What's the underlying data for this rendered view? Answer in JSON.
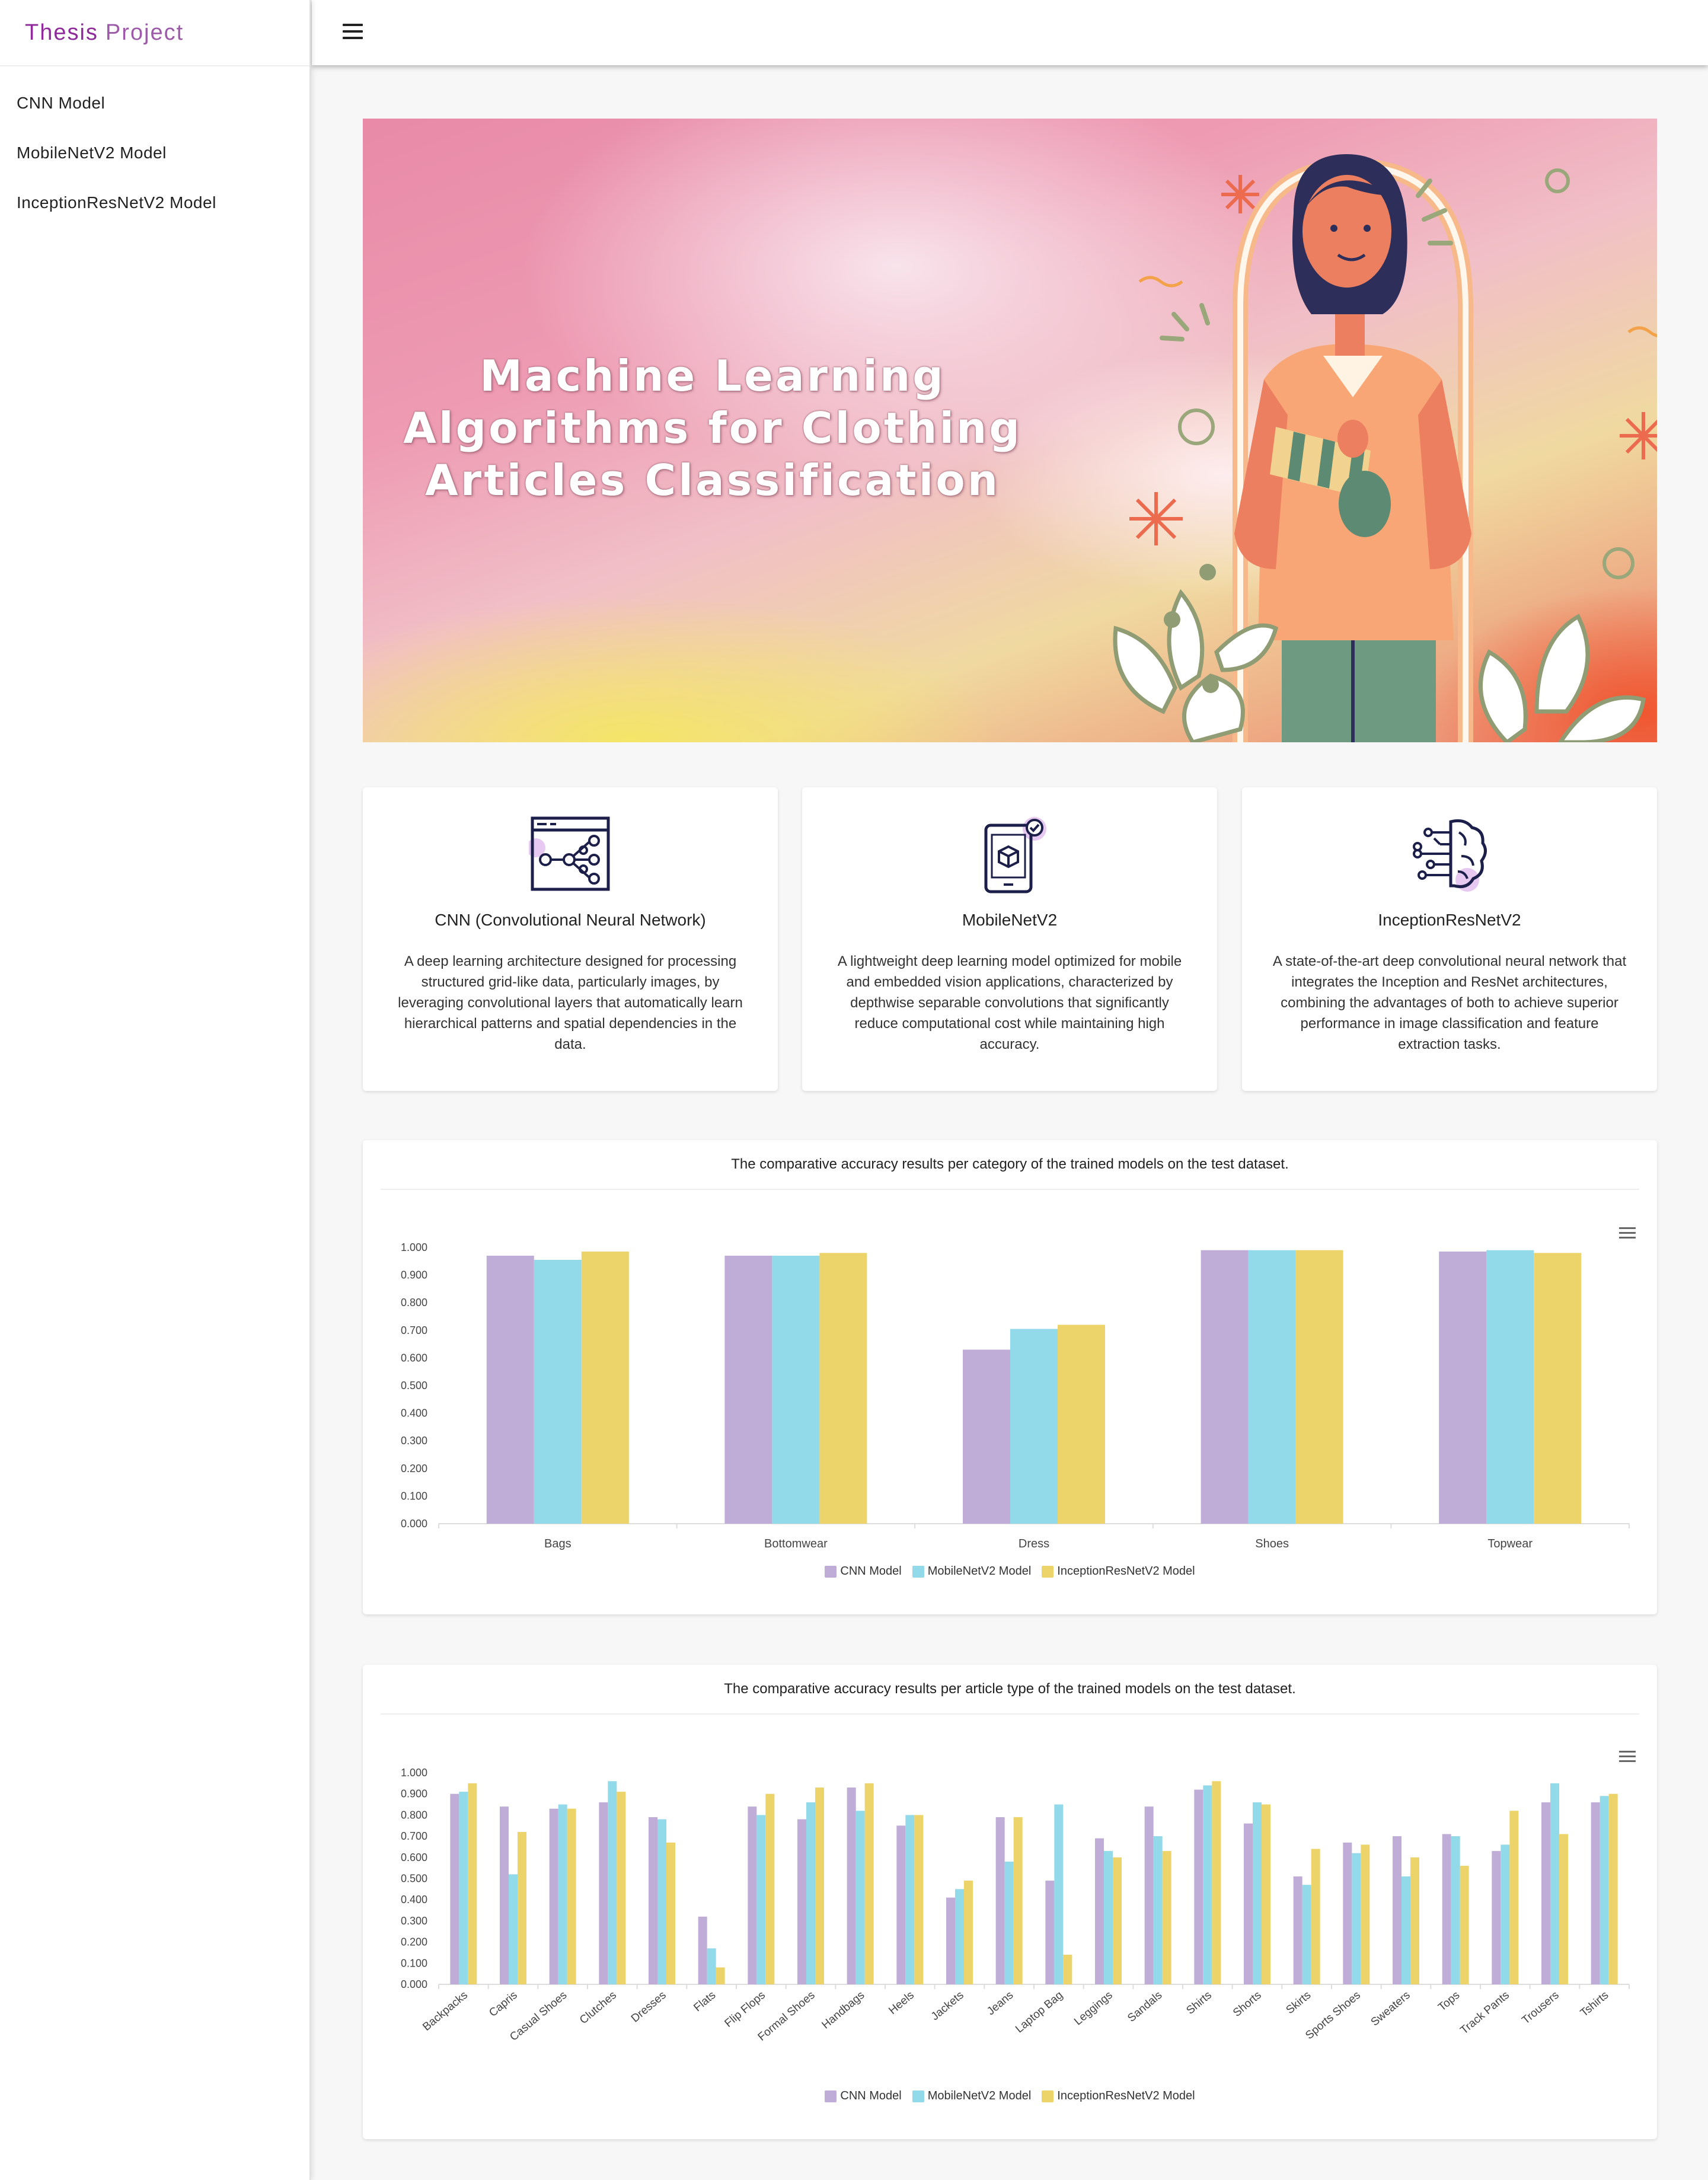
{
  "brand": {
    "part1": "Thesis",
    "part2": "Project"
  },
  "sidebar": {
    "items": [
      {
        "label": "CNN Model"
      },
      {
        "label": "MobileNetV2 Model"
      },
      {
        "label": "InceptionResNetV2 Model"
      }
    ]
  },
  "topbar": {
    "menu_icon": "hamburger-menu-icon"
  },
  "hero": {
    "title_lines": [
      "Machine Learning",
      "Algorithms for Clothing",
      "Articles Classification"
    ]
  },
  "cards": [
    {
      "icon": "neural-network-icon",
      "title": "CNN (Convolutional Neural Network)",
      "text": "A deep learning architecture designed for processing structured grid-like data, particularly images, by leveraging convolutional layers that automatically learn hierarchical patterns and spatial dependencies in the data."
    },
    {
      "icon": "mobile-cube-icon",
      "title": "MobileNetV2",
      "text": "A lightweight deep learning model optimized for mobile and embedded vision applications, characterized by depthwise separable convolutions that significantly reduce computational cost while maintaining high accuracy."
    },
    {
      "icon": "brain-circuit-icon",
      "title": "InceptionResNetV2",
      "text": "A state-of-the-art deep convolutional neural network that integrates the Inception and ResNet architectures, combining the advantages of both to achieve superior performance in image classification and feature extraction tasks."
    }
  ],
  "colors": {
    "cnn": "#bfadd8",
    "mobilenet": "#92d9ea",
    "inception": "#ecd46a",
    "accent": "#8e2a9a"
  },
  "chart_data": [
    {
      "type": "bar",
      "title": "The comparative accuracy results per category of the trained models on the test dataset.",
      "categories": [
        "Bags",
        "Bottomwear",
        "Dress",
        "Shoes",
        "Topwear"
      ],
      "ylim": [
        0,
        1
      ],
      "yticks": [
        "0.000",
        "0.100",
        "0.200",
        "0.300",
        "0.400",
        "0.500",
        "0.600",
        "0.700",
        "0.800",
        "0.900",
        "1.000"
      ],
      "legend_position": "bottom",
      "series": [
        {
          "name": "CNN Model",
          "values": [
            0.97,
            0.97,
            0.63,
            0.99,
            0.985
          ]
        },
        {
          "name": "MobileNetV2 Model",
          "values": [
            0.955,
            0.97,
            0.705,
            0.99,
            0.99
          ]
        },
        {
          "name": "InceptionResNetV2 Model",
          "values": [
            0.985,
            0.98,
            0.72,
            0.99,
            0.98
          ]
        }
      ]
    },
    {
      "type": "bar",
      "title": "The comparative accuracy results per article type of the trained models on the test dataset.",
      "categories": [
        "Backpacks",
        "Capris",
        "Casual Shoes",
        "Clutches",
        "Dresses",
        "Flats",
        "Flip Flops",
        "Formal Shoes",
        "Handbags",
        "Heels",
        "Jackets",
        "Jeans",
        "Laptop Bag",
        "Leggings",
        "Sandals",
        "Shirts",
        "Shorts",
        "Skirts",
        "Sports Shoes",
        "Sweaters",
        "Tops",
        "Track Pants",
        "Trousers",
        "Tshirts"
      ],
      "ylim": [
        0,
        1
      ],
      "yticks": [
        "0.000",
        "0.100",
        "0.200",
        "0.300",
        "0.400",
        "0.500",
        "0.600",
        "0.700",
        "0.800",
        "0.900",
        "1.000"
      ],
      "legend_position": "bottom",
      "series": [
        {
          "name": "CNN Model",
          "values": [
            0.9,
            0.84,
            0.83,
            0.86,
            0.79,
            0.32,
            0.84,
            0.78,
            0.93,
            0.75,
            0.41,
            0.79,
            0.49,
            0.69,
            0.84,
            0.92,
            0.76,
            0.51,
            0.67,
            0.7,
            0.71,
            0.63,
            0.86,
            0.86
          ]
        },
        {
          "name": "MobileNetV2 Model",
          "values": [
            0.91,
            0.52,
            0.85,
            0.96,
            0.78,
            0.17,
            0.8,
            0.86,
            0.82,
            0.8,
            0.45,
            0.58,
            0.85,
            0.63,
            0.7,
            0.94,
            0.86,
            0.47,
            0.62,
            0.51,
            0.7,
            0.66,
            0.95,
            0.89
          ]
        },
        {
          "name": "InceptionResNetV2 Model",
          "values": [
            0.95,
            0.72,
            0.83,
            0.91,
            0.67,
            0.08,
            0.9,
            0.93,
            0.95,
            0.8,
            0.49,
            0.79,
            0.14,
            0.6,
            0.63,
            0.96,
            0.85,
            0.64,
            0.66,
            0.6,
            0.56,
            0.82,
            0.71,
            0.9
          ]
        }
      ]
    }
  ]
}
